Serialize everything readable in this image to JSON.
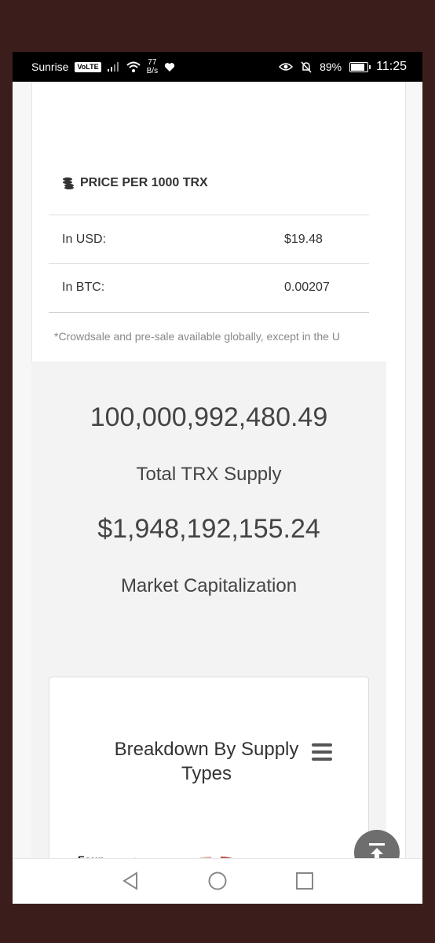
{
  "statusbar": {
    "carrier": "Sunrise",
    "volte": "VoLTE",
    "net_speed_value": "77",
    "net_speed_unit": "B/s",
    "battery": "89%",
    "time": "11:25",
    "battery_level": 0.89
  },
  "price": {
    "heading": "PRICE PER 1000 TRX",
    "rows": [
      {
        "label": "In USD:",
        "value": "$19.48"
      },
      {
        "label": "In BTC:",
        "value": "0.00207"
      }
    ],
    "note": "*Crowdsale and pre-sale available globally, except in the U"
  },
  "stats": {
    "supply_value": "100,000,992,480.49",
    "supply_label": "Total TRX Supply",
    "marketcap_value": "$1,948,192,155.24",
    "marketcap_label": "Market Capitalization"
  },
  "chart": {
    "title_line1": "Breakdown By Supply",
    "title_line2": "Types",
    "visible_label": "Foun..."
  },
  "chart_data": {
    "type": "pie",
    "title": "Breakdown By Supply Types",
    "slices": [
      {
        "name": "Foun...",
        "color": "#e2b3b0"
      },
      {
        "name": "",
        "color": "#b9504a"
      }
    ]
  },
  "icons": {
    "coins": "coins-icon",
    "menu": "hamburger-menu-icon",
    "scroll_top": "scroll-to-top-icon",
    "nav_back": "back-triangle-icon",
    "nav_home": "home-circle-icon",
    "nav_recents": "recents-square-icon"
  }
}
